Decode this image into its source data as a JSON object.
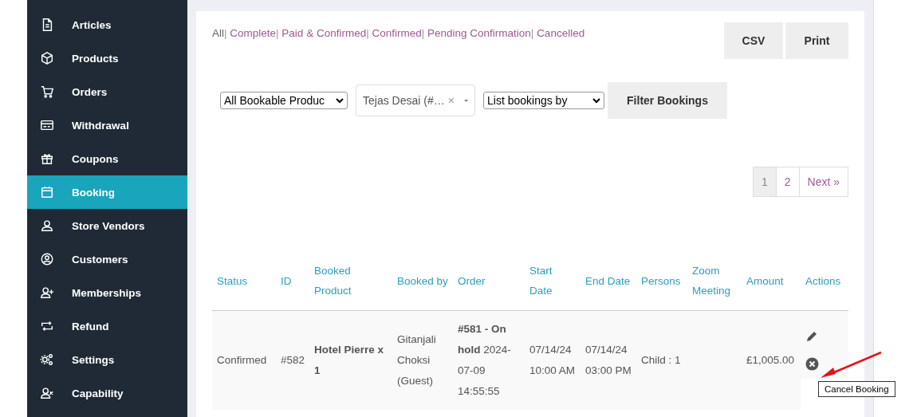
{
  "sidebar": {
    "items": [
      {
        "label": "Articles",
        "selected": false
      },
      {
        "label": "Products",
        "selected": false
      },
      {
        "label": "Orders",
        "selected": false
      },
      {
        "label": "Withdrawal",
        "selected": false
      },
      {
        "label": "Coupons",
        "selected": false
      },
      {
        "label": "Booking",
        "selected": true
      },
      {
        "label": "Store Vendors",
        "selected": false
      },
      {
        "label": "Customers",
        "selected": false
      },
      {
        "label": "Memberships",
        "selected": false
      },
      {
        "label": "Refund",
        "selected": false
      },
      {
        "label": "Settings",
        "selected": false
      },
      {
        "label": "Capability",
        "selected": false
      }
    ]
  },
  "status_separator": "|",
  "status_filters": [
    {
      "label": "All",
      "selected": true
    },
    {
      "label": "Complete",
      "selected": false
    },
    {
      "label": "Paid & Confirmed",
      "selected": false
    },
    {
      "label": "Confirmed",
      "selected": false
    },
    {
      "label": "Pending Confirmation",
      "selected": false
    },
    {
      "label": "Cancelled",
      "selected": false
    }
  ],
  "export_buttons": [
    "CSV",
    "Print"
  ],
  "filters": {
    "product_select": "All Bookable Produc",
    "customer_select": "Tejas Desai (#…",
    "list_by_select": "List bookings by",
    "clear_symbol": "×",
    "filter_button": "Filter Bookings"
  },
  "pagination": [
    {
      "label": "1",
      "selected": true
    },
    {
      "label": "2",
      "selected": false
    },
    {
      "label": "Next »",
      "selected": false
    }
  ],
  "table": {
    "columns": [
      "Status",
      "ID",
      "Booked Product",
      "Booked by",
      "Order",
      "Start Date",
      "End Date",
      "Persons",
      "Zoom Meeting",
      "Amount",
      "Actions"
    ],
    "rows": [
      {
        "status": "Confirmed",
        "id": "#582",
        "product": "Hotel Pierre x 1",
        "booked_by": "Gitanjali Choksi (Guest)",
        "order": "**#581 - On hold** 2024-07-09 14:55:55",
        "start": "07/14/24 10:00 AM",
        "end": "07/14/24 03:00 PM",
        "persons": "Child : 1",
        "amount": "£1,005.00"
      }
    ]
  },
  "tooltip": "Cancel Booking"
}
